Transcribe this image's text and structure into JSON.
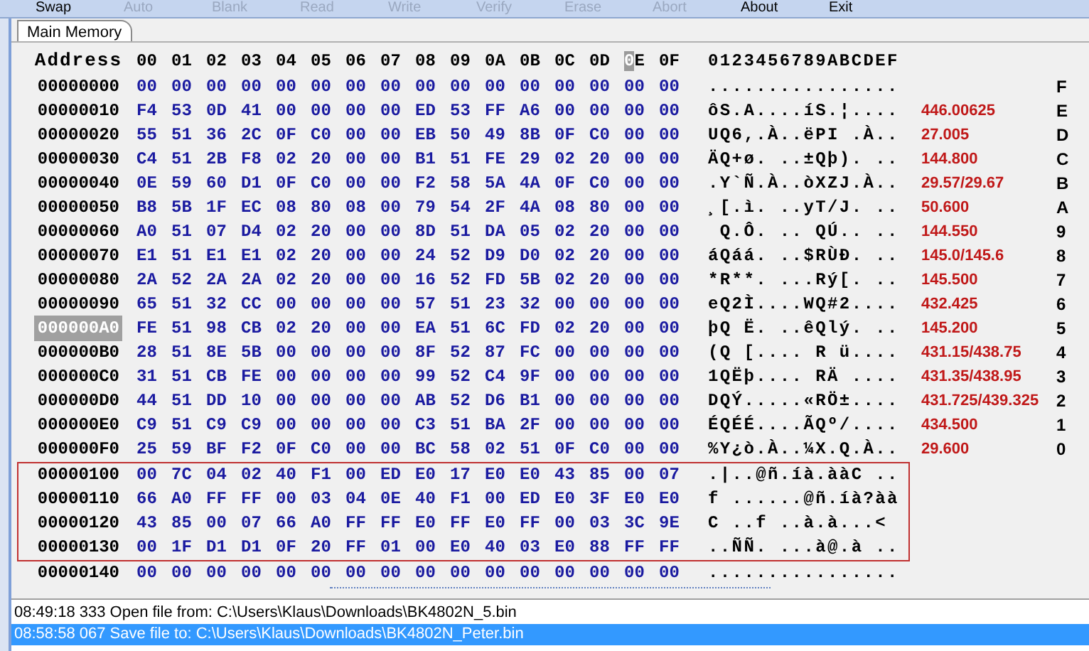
{
  "toolbar": [
    {
      "label": "Swap",
      "disabled": false
    },
    {
      "label": "Auto",
      "disabled": true
    },
    {
      "label": "Blank",
      "disabled": true
    },
    {
      "label": "Read",
      "disabled": true
    },
    {
      "label": "Write",
      "disabled": true
    },
    {
      "label": "Verify",
      "disabled": true
    },
    {
      "label": "Erase",
      "disabled": true
    },
    {
      "label": "Abort",
      "disabled": true
    },
    {
      "label": "About",
      "disabled": false
    },
    {
      "label": "Exit",
      "disabled": false
    }
  ],
  "tabs": [
    {
      "label": "Main Memory",
      "selected": true
    }
  ],
  "header": {
    "address": "Address",
    "columns": [
      {
        "label": "00",
        "cursor": false
      },
      {
        "label": "01",
        "cursor": false
      },
      {
        "label": "02",
        "cursor": false
      },
      {
        "label": "03",
        "cursor": false
      },
      {
        "label": "04",
        "cursor": false
      },
      {
        "label": "05",
        "cursor": false
      },
      {
        "label": "06",
        "cursor": false
      },
      {
        "label": "07",
        "cursor": false
      },
      {
        "label": "08",
        "cursor": false
      },
      {
        "label": "09",
        "cursor": false
      },
      {
        "label": "0A",
        "cursor": false
      },
      {
        "label": "0B",
        "cursor": false
      },
      {
        "label": "0C",
        "cursor": false
      },
      {
        "label": "0D",
        "cursor": false
      },
      {
        "label": "0E",
        "cursor": true
      },
      {
        "label": "0F",
        "cursor": false
      }
    ],
    "ascii": "0123456789ABCDEF"
  },
  "rows": [
    {
      "address": "00000000",
      "bytes": [
        "00",
        "00",
        "00",
        "00",
        "00",
        "00",
        "00",
        "00",
        "00",
        "00",
        "00",
        "00",
        "00",
        "00",
        "00",
        "00"
      ],
      "ascii": "................",
      "note": "",
      "label": "F",
      "selected": false,
      "boxed": false
    },
    {
      "address": "00000010",
      "bytes": [
        "F4",
        "53",
        "0D",
        "41",
        "00",
        "00",
        "00",
        "00",
        "ED",
        "53",
        "FF",
        "A6",
        "00",
        "00",
        "00",
        "00"
      ],
      "ascii": "ôS.A....íS.¦....",
      "note": "446.00625",
      "label": "E",
      "selected": false,
      "boxed": false
    },
    {
      "address": "00000020",
      "bytes": [
        "55",
        "51",
        "36",
        "2C",
        "0F",
        "C0",
        "00",
        "00",
        "EB",
        "50",
        "49",
        "8B",
        "0F",
        "C0",
        "00",
        "00"
      ],
      "ascii": "UQ6,.À..ëPI .À..",
      "note": "27.005",
      "label": "D",
      "selected": false,
      "boxed": false
    },
    {
      "address": "00000030",
      "bytes": [
        "C4",
        "51",
        "2B",
        "F8",
        "02",
        "20",
        "00",
        "00",
        "B1",
        "51",
        "FE",
        "29",
        "02",
        "20",
        "00",
        "00"
      ],
      "ascii": "ÄQ+ø. ..±Qþ). ..",
      "note": "144.800",
      "label": "C",
      "selected": false,
      "boxed": false
    },
    {
      "address": "00000040",
      "bytes": [
        "0E",
        "59",
        "60",
        "D1",
        "0F",
        "C0",
        "00",
        "00",
        "F2",
        "58",
        "5A",
        "4A",
        "0F",
        "C0",
        "00",
        "00"
      ],
      "ascii": ".Y`Ñ.À..òXZJ.À..",
      "note": "29.57/29.67",
      "label": "B",
      "selected": false,
      "boxed": false
    },
    {
      "address": "00000050",
      "bytes": [
        "B8",
        "5B",
        "1F",
        "EC",
        "08",
        "80",
        "08",
        "00",
        "79",
        "54",
        "2F",
        "4A",
        "08",
        "80",
        "00",
        "00"
      ],
      "ascii": "¸[.ì. ..yT/J. ..",
      "note": "50.600",
      "label": "A",
      "selected": false,
      "boxed": false
    },
    {
      "address": "00000060",
      "bytes": [
        "A0",
        "51",
        "07",
        "D4",
        "02",
        "20",
        "00",
        "00",
        "8D",
        "51",
        "DA",
        "05",
        "02",
        "20",
        "00",
        "00"
      ],
      "ascii": " Q.Ô. .. QÚ.. ..",
      "note": "144.550",
      "label": "9",
      "selected": false,
      "boxed": false
    },
    {
      "address": "00000070",
      "bytes": [
        "E1",
        "51",
        "E1",
        "E1",
        "02",
        "20",
        "00",
        "00",
        "24",
        "52",
        "D9",
        "D0",
        "02",
        "20",
        "00",
        "00"
      ],
      "ascii": "áQáá. ..$RÙÐ. ..",
      "note": "145.0/145.6",
      "label": "8",
      "selected": false,
      "boxed": false
    },
    {
      "address": "00000080",
      "bytes": [
        "2A",
        "52",
        "2A",
        "2A",
        "02",
        "20",
        "00",
        "00",
        "16",
        "52",
        "FD",
        "5B",
        "02",
        "20",
        "00",
        "00"
      ],
      "ascii": "*R**. ...Rý[. ..",
      "note": "145.500",
      "label": "7",
      "selected": false,
      "boxed": false
    },
    {
      "address": "00000090",
      "bytes": [
        "65",
        "51",
        "32",
        "CC",
        "00",
        "00",
        "00",
        "00",
        "57",
        "51",
        "23",
        "32",
        "00",
        "00",
        "00",
        "00"
      ],
      "ascii": "eQ2Ì....WQ#2....",
      "note": "432.425",
      "label": "6",
      "selected": false,
      "boxed": false
    },
    {
      "address": "000000A0",
      "bytes": [
        "FE",
        "51",
        "98",
        "CB",
        "02",
        "20",
        "00",
        "00",
        "EA",
        "51",
        "6C",
        "FD",
        "02",
        "20",
        "00",
        "00"
      ],
      "ascii": "þQ Ë. ..êQlý. ..",
      "note": "145.200",
      "label": "5",
      "selected": true,
      "boxed": false
    },
    {
      "address": "000000B0",
      "bytes": [
        "28",
        "51",
        "8E",
        "5B",
        "00",
        "00",
        "00",
        "00",
        "8F",
        "52",
        "87",
        "FC",
        "00",
        "00",
        "00",
        "00"
      ],
      "ascii": "(Q [.... R ü....",
      "note": "431.15/438.75",
      "label": "4",
      "selected": false,
      "boxed": false
    },
    {
      "address": "000000C0",
      "bytes": [
        "31",
        "51",
        "CB",
        "FE",
        "00",
        "00",
        "00",
        "00",
        "99",
        "52",
        "C4",
        "9F",
        "00",
        "00",
        "00",
        "00"
      ],
      "ascii": "1QËþ.... RÄ ....",
      "note": "431.35/438.95",
      "label": "3",
      "selected": false,
      "boxed": false
    },
    {
      "address": "000000D0",
      "bytes": [
        "44",
        "51",
        "DD",
        "10",
        "00",
        "00",
        "00",
        "00",
        "AB",
        "52",
        "D6",
        "B1",
        "00",
        "00",
        "00",
        "00"
      ],
      "ascii": "DQÝ.....«RÖ±....",
      "note": "431.725/439.325",
      "label": "2",
      "selected": false,
      "boxed": false
    },
    {
      "address": "000000E0",
      "bytes": [
        "C9",
        "51",
        "C9",
        "C9",
        "00",
        "00",
        "00",
        "00",
        "C3",
        "51",
        "BA",
        "2F",
        "00",
        "00",
        "00",
        "00"
      ],
      "ascii": "ÉQÉÉ....ÃQº/....",
      "note": "434.500",
      "label": "1",
      "selected": false,
      "boxed": false
    },
    {
      "address": "000000F0",
      "bytes": [
        "25",
        "59",
        "BF",
        "F2",
        "0F",
        "C0",
        "00",
        "00",
        "BC",
        "58",
        "02",
        "51",
        "0F",
        "C0",
        "00",
        "00"
      ],
      "ascii": "%Y¿ò.À..¼X.Q.À..",
      "note": "29.600",
      "label": "0",
      "selected": false,
      "boxed": false
    },
    {
      "address": "00000100",
      "bytes": [
        "00",
        "7C",
        "04",
        "02",
        "40",
        "F1",
        "00",
        "ED",
        "E0",
        "17",
        "E0",
        "E0",
        "43",
        "85",
        "00",
        "07"
      ],
      "ascii": ".|..@ñ.íà.ààC ..",
      "note": "",
      "label": "",
      "selected": false,
      "boxed": true
    },
    {
      "address": "00000110",
      "bytes": [
        "66",
        "A0",
        "FF",
        "FF",
        "00",
        "03",
        "04",
        "0E",
        "40",
        "F1",
        "00",
        "ED",
        "E0",
        "3F",
        "E0",
        "E0"
      ],
      "ascii": "f ......@ñ.íà?àà",
      "note": "",
      "label": "",
      "selected": false,
      "boxed": true
    },
    {
      "address": "00000120",
      "bytes": [
        "43",
        "85",
        "00",
        "07",
        "66",
        "A0",
        "FF",
        "FF",
        "E0",
        "FF",
        "E0",
        "FF",
        "00",
        "03",
        "3C",
        "9E"
      ],
      "ascii": "C ..f ..à.à...<",
      "note": "",
      "label": "",
      "selected": false,
      "boxed": true
    },
    {
      "address": "00000130",
      "bytes": [
        "00",
        "1F",
        "D1",
        "D1",
        "0F",
        "20",
        "FF",
        "01",
        "00",
        "E0",
        "40",
        "03",
        "E0",
        "88",
        "FF",
        "FF"
      ],
      "ascii": "..ÑÑ. ...à@.à ..",
      "note": "",
      "label": "",
      "selected": false,
      "boxed": true
    },
    {
      "address": "00000140",
      "bytes": [
        "00",
        "00",
        "00",
        "00",
        "00",
        "00",
        "00",
        "00",
        "00",
        "00",
        "00",
        "00",
        "00",
        "00",
        "00",
        "00"
      ],
      "ascii": "................",
      "note": "",
      "label": "",
      "selected": false,
      "boxed": false
    }
  ],
  "log": [
    {
      "text": "08:49:18 333 Open file from: C:\\Users\\Klaus\\Downloads\\BK4802N_5.bin",
      "selected": false
    },
    {
      "text": "08:58:58 067 Save file to: C:\\Users\\Klaus\\Downloads\\BK4802N_Peter.bin",
      "selected": true
    }
  ]
}
